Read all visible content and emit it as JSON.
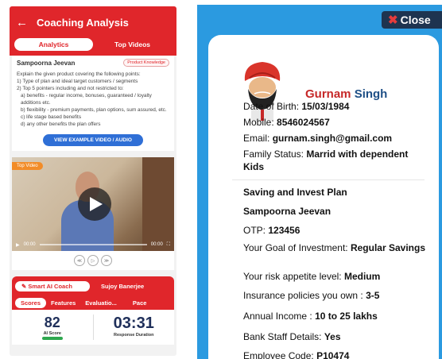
{
  "left": {
    "header_title": "Coaching Analysis",
    "tabs": [
      {
        "label": "Analytics",
        "active": true
      },
      {
        "label": "Top Videos",
        "active": false
      }
    ],
    "product_name": "Sampoorna Jeevan",
    "product_tag": "Product Knowledge",
    "instructions": [
      "Explain the given product covering the following points:",
      "1)    Type of plan and ideal target customers / segments",
      "2)    Top 5 pointers including and not restricted to:",
      "   a) benefits - regular income, bonuses, guaranteed / loyalty additions etc.",
      "   b) flexibility - premium payments, plan options, sum assured, etc.",
      "   c) life stage based benefits",
      "   d) any other benefits the plan offers"
    ],
    "example_button": "VIEW EXAMPLE VIDEO / AUDIO",
    "video": {
      "tag": "Top Video",
      "time_current": "00:00",
      "time_total": "00:00"
    },
    "coach": {
      "button": "Smart AI Coach",
      "person": "Sujoy Banerjee"
    },
    "score_tabs": [
      "Scores",
      "Features",
      "Evaluatio...",
      "Pace"
    ],
    "ai_score": "82",
    "ai_score_label": "AI Score",
    "response_duration": "03:31",
    "response_label": "Response Duration"
  },
  "right": {
    "close_label": "Close",
    "first_name": "Gurnam",
    "last_name": "Singh",
    "fields": [
      {
        "label": "Date of Birth: ",
        "value": "15/03/1984"
      },
      {
        "label": "Mobile: ",
        "value": "8546024567"
      },
      {
        "label": "Email: ",
        "value": "gurnam.singh@gmail.com"
      },
      {
        "label": "Family Status: ",
        "value": "Marrid with dependent  Kids"
      }
    ],
    "plan_fields": [
      {
        "label": "",
        "value": "Saving and Invest Plan"
      },
      {
        "label": "",
        "value": "Sampoorna Jeevan"
      },
      {
        "label": "OTP: ",
        "value": "123456"
      },
      {
        "label": "Your Goal of Investment: ",
        "value": "Regular Savings"
      },
      {
        "label": "Your risk appetite level: ",
        "value": "Medium"
      },
      {
        "label": "Insurance policies you own : ",
        "value": "3-5"
      },
      {
        "label": "Annual Income : ",
        "value": "10 to 25 lakhs"
      },
      {
        "label": "Bank Staff Details: ",
        "value": "Yes"
      },
      {
        "label": "Employee Code: ",
        "value": "P10474"
      }
    ]
  }
}
